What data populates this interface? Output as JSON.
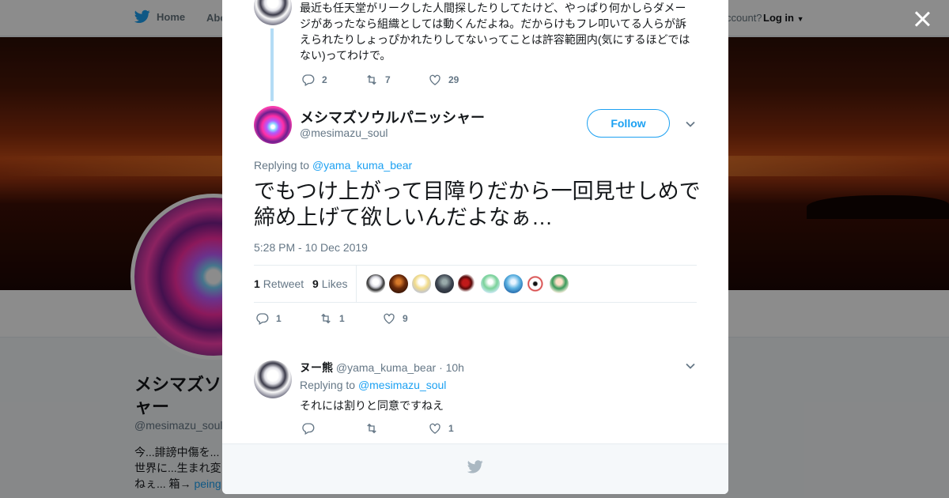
{
  "background": {
    "nav": {
      "home": "Home",
      "about": "Abo",
      "have_account": "ccount?",
      "login": "Log in"
    },
    "profile": {
      "name": "メシマズソ ャー",
      "handle": "@mesimazu_soul",
      "bio": "今...誹謗中傷を... 世界に...生まれ変 ねぇ... 箱→",
      "bio_link": "peing"
    }
  },
  "previous_tweet": {
    "text": "最近も任天堂がリークした人間探したりしてたけど、やっぱり何かしらダメージがあったなら組織としては動くんだよね。だからけもフレ叩いてる人らが訴えられたりしょっぴかれたりしてないってことは許容範囲内(気にするほどではない)ってわけで。",
    "replies": "2",
    "retweets": "7",
    "likes": "29"
  },
  "main_tweet": {
    "name": "メシマズソウルパニッシャー",
    "handle": "@mesimazu_soul",
    "follow_label": "Follow",
    "replying_label": "Replying to",
    "replying_to": "@yama_kuma_bear",
    "text": "でもつけ上がって目障りだから一回見せしめで締め上げて欲しいんだよなぁ…",
    "timestamp": "5:28 PM - 10 Dec 2019",
    "retweet_count": "1",
    "retweet_label": "Retweet",
    "like_count": "9",
    "like_label": "Likes",
    "replies": "1",
    "retweets": "1",
    "likes": "9"
  },
  "reply_tweet": {
    "name": "ヌー熊",
    "handle": "@yama_kuma_bear",
    "time": "· 10h",
    "replying_label": "Replying to",
    "replying_to": "@mesimazu_soul",
    "text": "それには割りと同意ですねえ",
    "replies": "",
    "retweets": "",
    "likes": "1"
  },
  "colors": {
    "accent": "#1da1f2",
    "thread_line": "#b4dcf5",
    "muted": "#657786"
  },
  "icons": [
    "twitter-bird-icon",
    "close-icon",
    "reply-icon",
    "retweet-icon",
    "like-icon",
    "chevron-down-icon",
    "caret-down-icon"
  ]
}
